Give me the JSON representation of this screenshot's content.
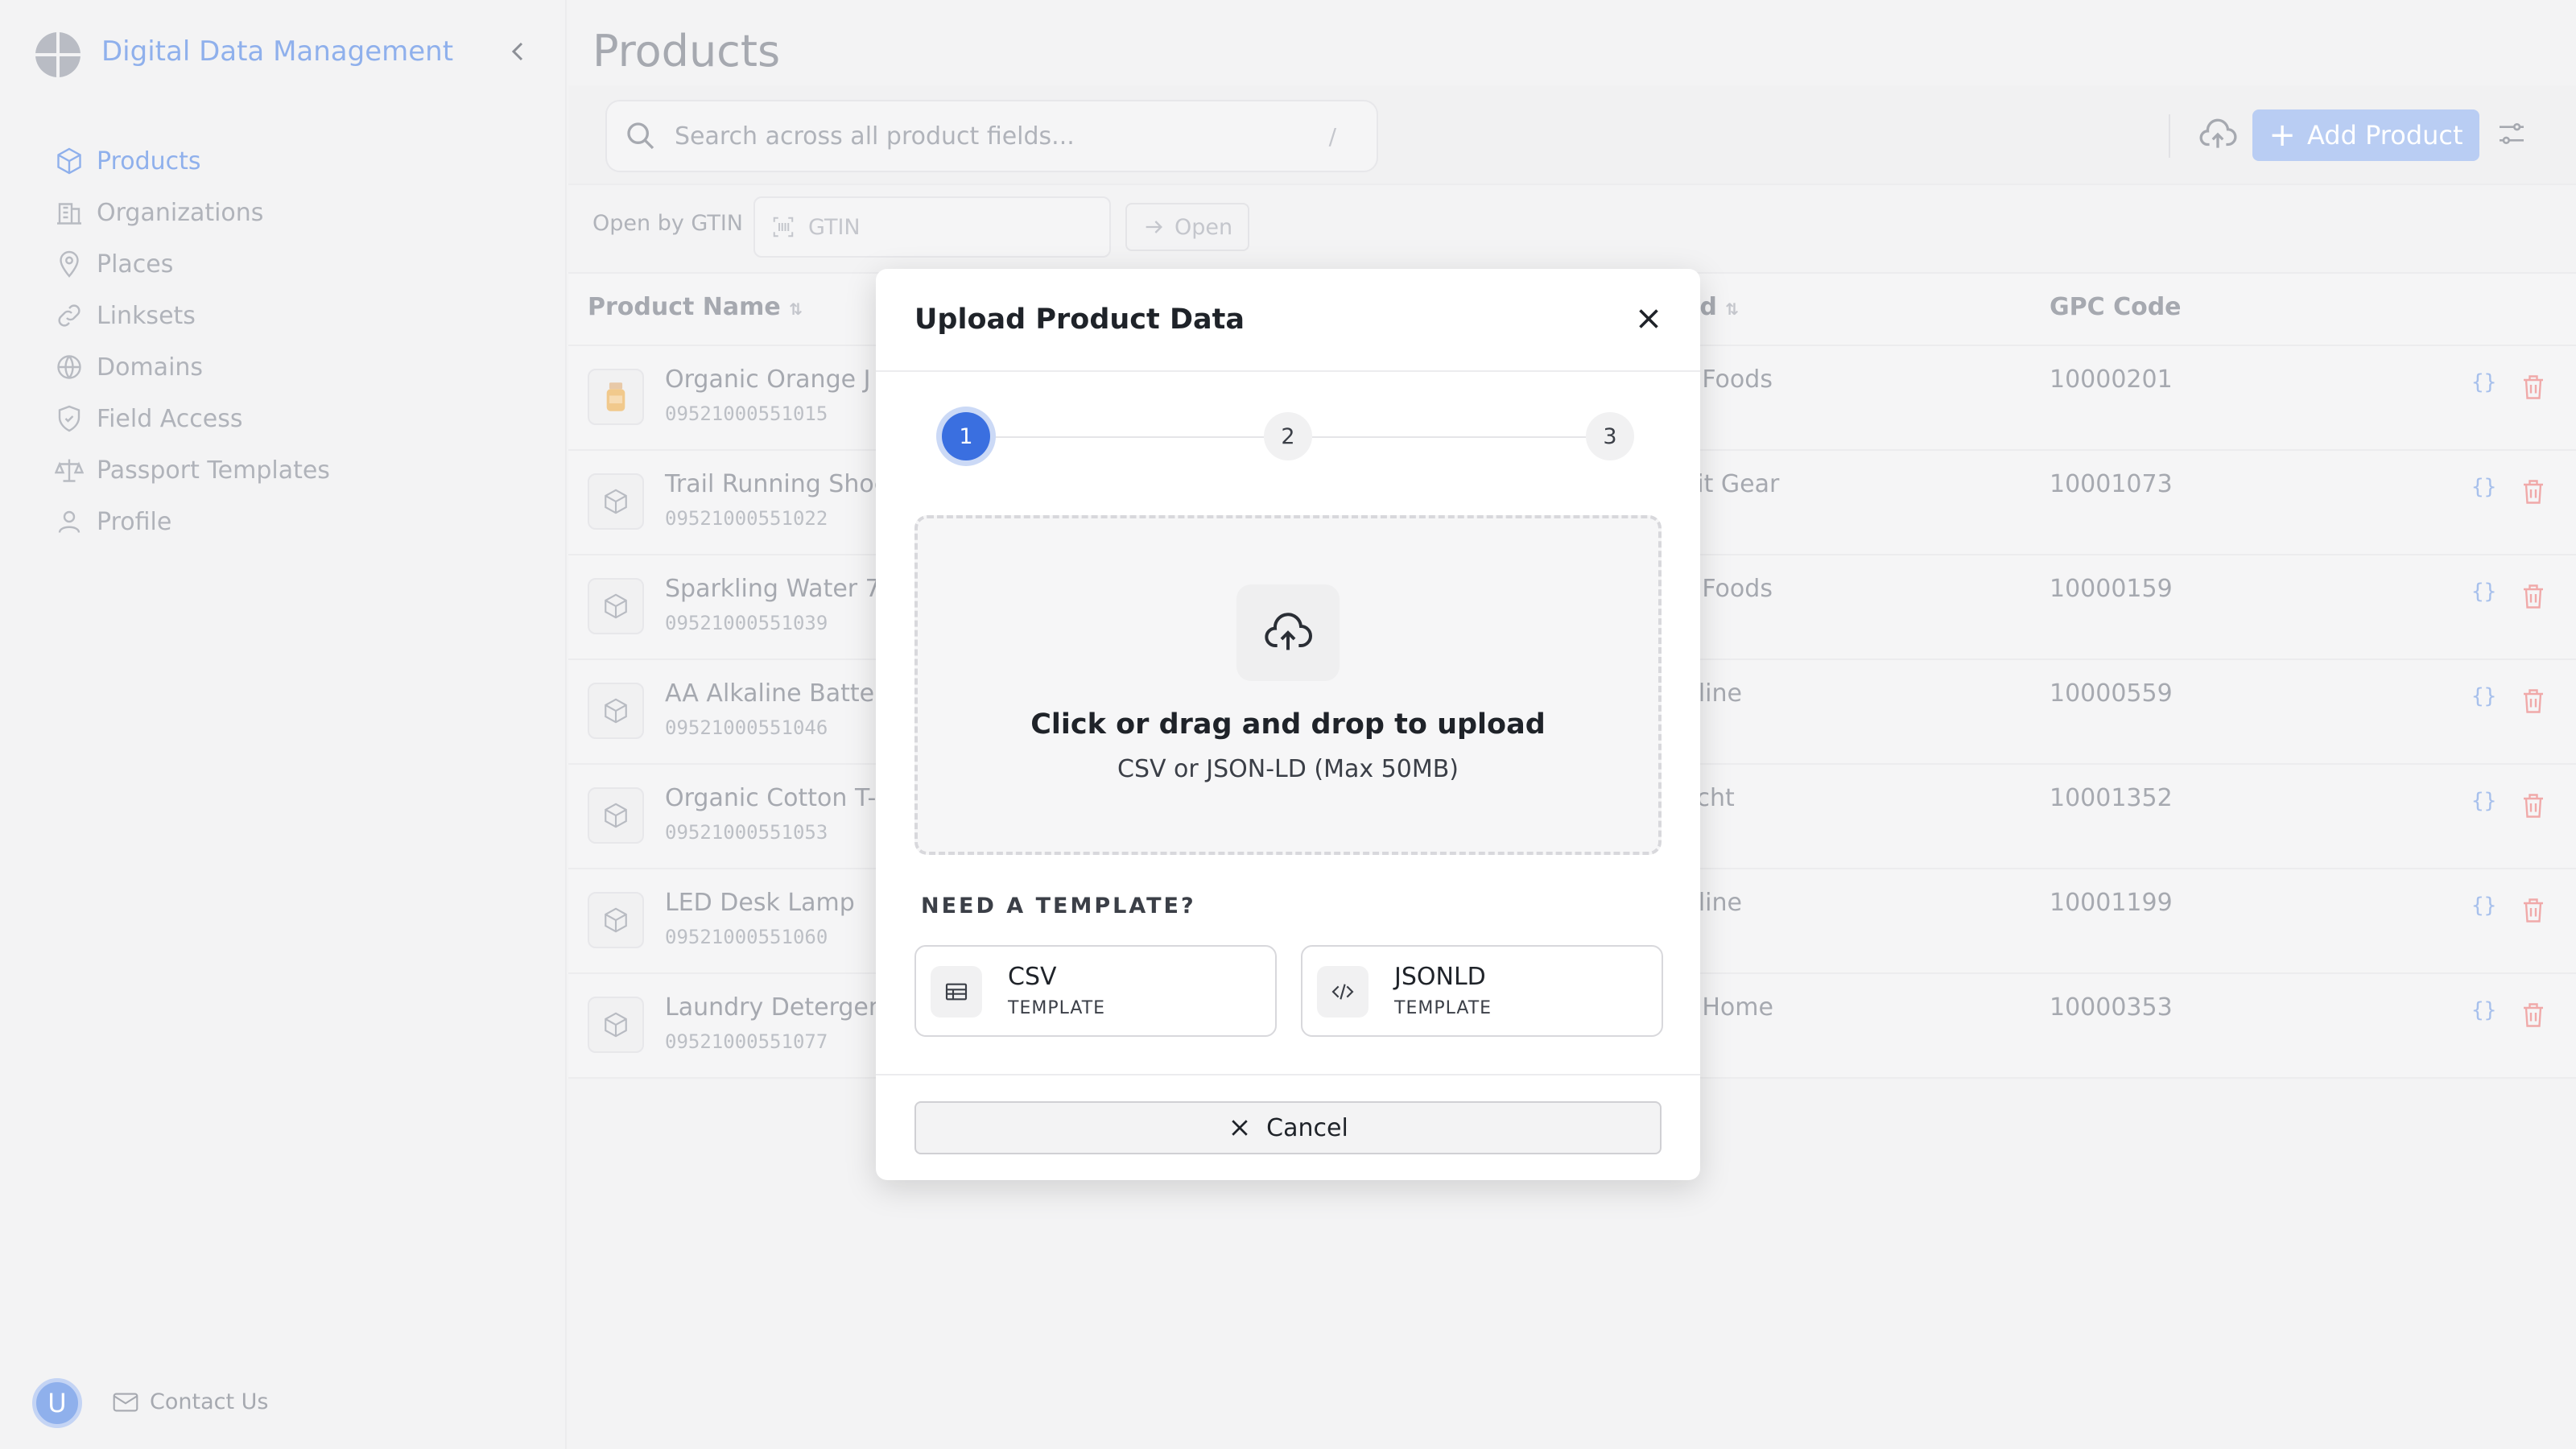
{
  "app": {
    "title": "Digital Data Management"
  },
  "sidebar": {
    "items": [
      {
        "label": "Products",
        "icon": "box-icon",
        "active": true
      },
      {
        "label": "Organizations",
        "icon": "building-icon"
      },
      {
        "label": "Places",
        "icon": "map-pin-icon"
      },
      {
        "label": "Linksets",
        "icon": "link-icon"
      },
      {
        "label": "Domains",
        "icon": "globe-icon"
      },
      {
        "label": "Field Access",
        "icon": "shield-icon"
      },
      {
        "label": "Passport Templates",
        "icon": "scale-icon"
      },
      {
        "label": "Profile",
        "icon": "user-icon"
      }
    ],
    "avatar_initial": "U",
    "contact_label": "Contact Us"
  },
  "page": {
    "title": "Products"
  },
  "toolbar": {
    "search_placeholder": "Search across all product fields...",
    "search_shortcut": "/",
    "add_label": "Add Product"
  },
  "gtin": {
    "label": "Open by GTIN",
    "placeholder": "GTIN",
    "open_label": "Open"
  },
  "table": {
    "columns": [
      "Product Name",
      "nd",
      "GPC Code"
    ],
    "rows": [
      {
        "name": "Organic Orange J",
        "gtin": "09521000551015",
        "brand": "ME Foods",
        "gpc": "10000201",
        "json": "{}"
      },
      {
        "name": "Trail Running Shoe",
        "gtin": "09521000551022",
        "brand": "nmit Gear",
        "gpc": "10001073",
        "json": "{}"
      },
      {
        "name": "Sparkling Water 7",
        "gtin": "09521000551039",
        "brand": "ME Foods",
        "gpc": "10000159",
        "json": "{}"
      },
      {
        "name": "AA Alkaline Batte",
        "gtin": "09521000551046",
        "brand": "ghtline",
        "gpc": "10000559",
        "json": "{}"
      },
      {
        "name": "Organic Cotton T-",
        "gtin": "09521000551053",
        "brand": "rdlicht",
        "gpc": "10001352",
        "json": "{}"
      },
      {
        "name": "LED Desk Lamp",
        "gtin": "09521000551060",
        "brand": "ghtline",
        "gpc": "10001199",
        "json": "{}"
      },
      {
        "name": "Laundry Detergen",
        "gtin": "09521000551077",
        "brand": "ME Home",
        "gpc": "10000353",
        "json": "{}"
      }
    ]
  },
  "modal": {
    "title": "Upload Product Data",
    "steps": [
      "1",
      "2",
      "3"
    ],
    "current_step": 1,
    "dropzone_title": "Click or drag and drop to upload",
    "dropzone_sub": "CSV or JSON-LD (Max 50MB)",
    "template_heading": "NEED A TEMPLATE?",
    "templates": [
      {
        "name": "CSV",
        "sub": "TEMPLATE",
        "icon": "table-icon"
      },
      {
        "name": "JSONLD",
        "sub": "TEMPLATE",
        "icon": "code-icon"
      }
    ],
    "cancel_label": "Cancel"
  },
  "colors": {
    "accent": "#3a6fe0",
    "danger": "#e05656"
  }
}
